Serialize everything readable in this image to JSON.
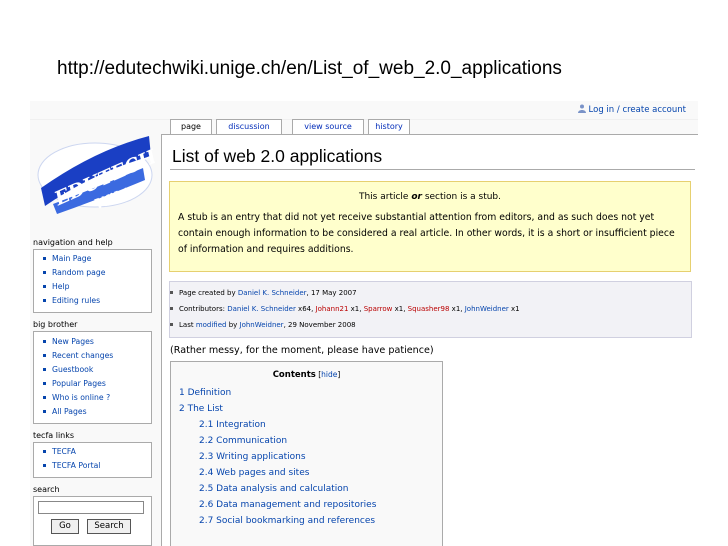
{
  "slide_url": "http://edutechwiki.unige.ch/en/List_of_web_2.0_applications",
  "login_link": "Log in / create account",
  "logo": {
    "text_top": "EDUTECH",
    "text_bottom": "Wiki"
  },
  "tabs": [
    "page",
    "discussion",
    "view source",
    "history"
  ],
  "page_title": "List of web 2.0 applications",
  "stub": {
    "title_pre": "This article ",
    "title_em": "or",
    "title_post": " section is a stub.",
    "text": "A stub is an entry that did not yet receive substantial attention from editors, and as such does not yet contain enough information to be considered a real article. In other words, it is a short or insufficient piece of information and requires additions."
  },
  "meta": {
    "created_label": "Page created by ",
    "created_by": "Daniel K. Schneider",
    "created_date": ", 17 May 2007",
    "contributors_label": "Contributors: ",
    "c1": "Daniel K. Schneider",
    "c1n": " x64, ",
    "c2": "Johann21",
    "c2n": " x1, ",
    "c3": "Sparrow",
    "c3n": " x1, ",
    "c4": "Squasher98",
    "c4n": " x1, ",
    "c5": "JohnWeidner",
    "c5n": " x1",
    "last_pre": "Last ",
    "last_link": "modified",
    "last_mid": " by ",
    "last_user": "JohnWeidner",
    "last_date": ", 29 November 2008"
  },
  "patience_text": "(Rather messy, for the moment, please have patience)",
  "toc": {
    "title": "Contents",
    "hide_open": " [",
    "hide_label": "hide",
    "hide_close": "]",
    "items": [
      "1 Definition",
      "2 The List",
      "2.1 Integration",
      "2.2 Communication",
      "2.3 Writing applications",
      "2.4 Web pages and sites",
      "2.5 Data analysis and calculation",
      "2.6 Data management and repositories",
      "2.7 Social bookmarking and references"
    ]
  },
  "sidebar": {
    "nav_heading": "navigation and help",
    "nav_items": [
      "Main Page",
      "Random page",
      "Help",
      "Editing rules"
    ],
    "bb_heading": "big brother",
    "bb_items": [
      "New Pages",
      "Recent changes",
      "Guestbook",
      "Popular Pages",
      "Who is online ?",
      "All Pages"
    ],
    "tecfa_heading": "tecfa links",
    "tecfa_items": [
      "TECFA",
      "TECFA Portal"
    ],
    "search_heading": "search",
    "go_label": "Go",
    "search_label": "Search"
  },
  "colors": {
    "link": "#0645ad",
    "redlink": "#ba0000",
    "stub_bg": "#ffffcc",
    "logo_blue": "#1a3fc4"
  }
}
